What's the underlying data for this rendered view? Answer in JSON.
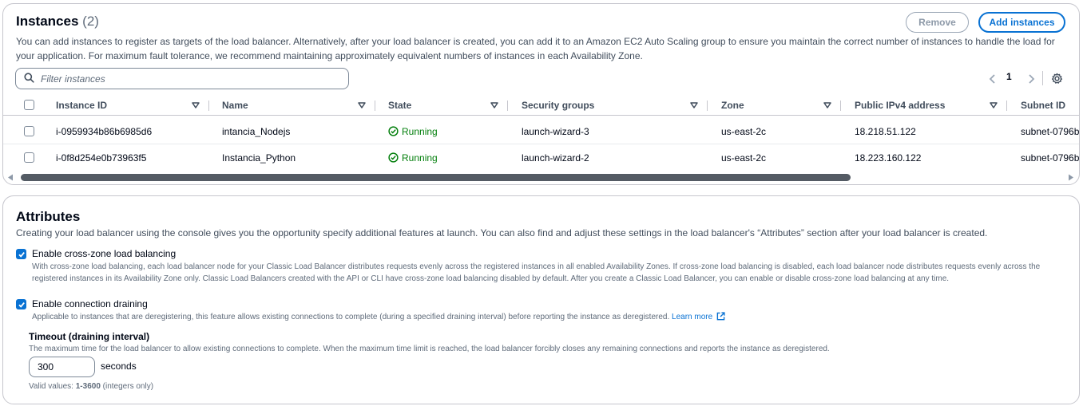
{
  "instances": {
    "title": "Instances",
    "count": "(2)",
    "remove_label": "Remove",
    "add_label": "Add instances",
    "description": "You can add instances to register as targets of the load balancer. Alternatively, after your load balancer is created, you can add it to an Amazon EC2 Auto Scaling group to ensure you maintain the correct number of instances to handle the load for your application. For maximum fault tolerance, we recommend maintaining approximately equivalent numbers of instances in each Availability Zone.",
    "search_placeholder": "Filter instances",
    "page": "1",
    "columns": [
      "Instance ID",
      "Name",
      "State",
      "Security groups",
      "Zone",
      "Public IPv4 address",
      "Subnet ID"
    ],
    "rows": [
      {
        "id": "i-0959934b86b6985d6",
        "name": "intancia_Nodejs",
        "state": "Running",
        "sg": "launch-wizard-3",
        "zone": "us-east-2c",
        "ip": "18.218.51.122",
        "subnet": "subnet-0796b"
      },
      {
        "id": "i-0f8d254e0b73963f5",
        "name": "Instancia_Python",
        "state": "Running",
        "sg": "launch-wizard-2",
        "zone": "us-east-2c",
        "ip": "18.223.160.122",
        "subnet": "subnet-0796b"
      }
    ]
  },
  "attributes": {
    "title": "Attributes",
    "description": "Creating your load balancer using the console gives you the opportunity specify additional features at launch. You can also find and adjust these settings in the load balancer's “Attributes” section after your load balancer is created.",
    "cross_zone": {
      "checked": true,
      "label": "Enable cross-zone load balancing",
      "description": "With cross-zone load balancing, each load balancer node for your Classic Load Balancer distributes requests evenly across the registered instances in all enabled Availability Zones. If cross-zone load balancing is disabled, each load balancer node distributes requests evenly across the registered instances in its Availability Zone only. Classic Load Balancers created with the API or CLI have cross-zone load balancing disabled by default. After you create a Classic Load Balancer, you can enable or disable cross-zone load balancing at any time."
    },
    "draining": {
      "checked": true,
      "label": "Enable connection draining",
      "description": "Applicable to instances that are deregistering, this feature allows existing connections to complete (during a specified draining interval) before reporting the instance as deregistered.",
      "learn_more": "Learn more",
      "timeout_label": "Timeout (draining interval)",
      "timeout_description": "The maximum time for the load balancer to allow existing connections to complete. When the maximum time limit is reached, the load balancer forcibly closes any remaining connections and reports the instance as deregistered.",
      "timeout_value": "300",
      "timeout_unit": "seconds",
      "valid_prefix": "Valid values: ",
      "valid_range": "1-3600",
      "valid_suffix": " (integers only)"
    }
  },
  "colors": {
    "accent": "#0972d3",
    "success": "#037f0c",
    "border": "#c6c6cd"
  }
}
